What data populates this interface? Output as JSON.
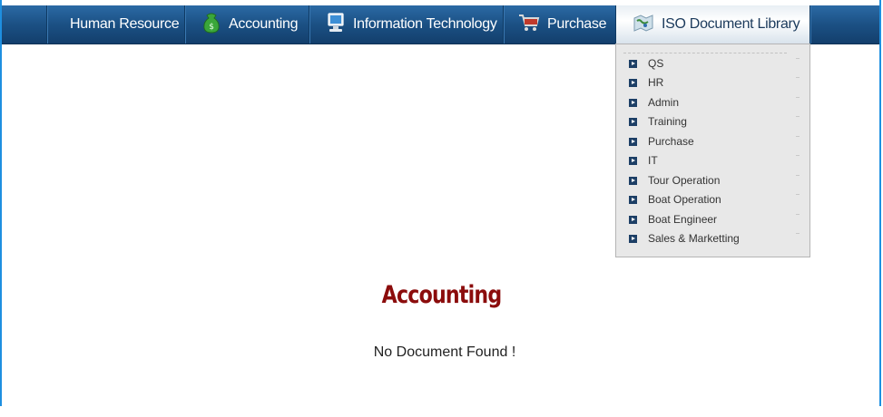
{
  "nav": {
    "items": [
      {
        "label": "Human Resource",
        "icon": ""
      },
      {
        "label": "Accounting",
        "icon": "money-bag-icon"
      },
      {
        "label": "Information Technology",
        "icon": "computer-icon"
      },
      {
        "label": "Purchase",
        "icon": "shopping-cart-icon"
      },
      {
        "label": "ISO Document  Library",
        "icon": "world-map-icon"
      }
    ]
  },
  "dropdown": {
    "items": [
      "QS",
      "HR",
      "Admin",
      "Training",
      "Purchase",
      "IT",
      "Tour Operation",
      "Boat Operation",
      "Boat Engineer",
      "Sales & Marketting"
    ]
  },
  "main": {
    "title": "Accounting",
    "message": "No Document Found !"
  },
  "colors": {
    "navbar": "#1b5084",
    "title": "#8b0c0c",
    "frame": "#1e8fe0"
  }
}
